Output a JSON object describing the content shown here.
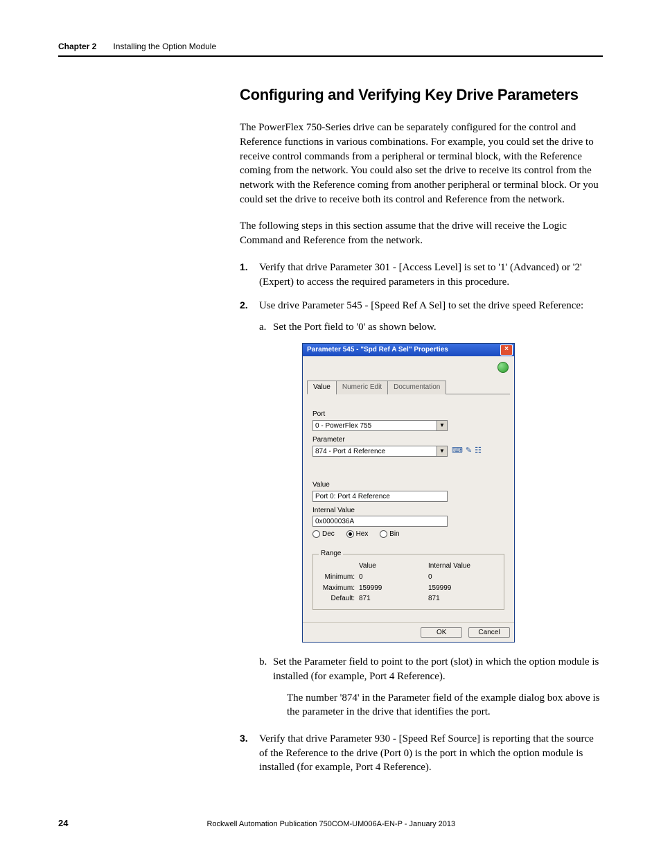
{
  "header": {
    "chapter": "Chapter 2",
    "title": "Installing the Option Module"
  },
  "section_heading": "Configuring and Verifying Key Drive Parameters",
  "para1": "The PowerFlex 750-Series drive can be separately configured for the control and Reference functions in various combinations. For example, you could set the drive to receive control commands from a peripheral or terminal block, with the Reference coming from the network. You could also set the drive to receive its control from the network with the Reference coming from another peripheral or terminal block. Or you could set the drive to receive both its control and Reference from the network.",
  "para2": "The following steps in this section assume that the drive will receive the Logic Command and Reference from the network.",
  "steps": {
    "s1": "Verify that drive Parameter 301 - [Access Level] is set to '1' (Advanced) or '2' (Expert) to access the required parameters in this procedure.",
    "s2": "Use drive Parameter 545 - [Speed Ref A Sel] to set the drive speed Reference:",
    "s2a": "Set the Port field to '0' as shown below.",
    "s2b": "Set the Parameter field to point to the port (slot) in which the option module is installed (for example, Port 4 Reference).",
    "s2b_note": "The number '874' in the Parameter field of the example dialog box above is the parameter in the drive that identifies the port.",
    "s3": "Verify that drive Parameter 930 - [Speed Ref Source] is reporting that the source of the Reference to the drive (Port 0) is the port in which the option module is installed (for example, Port 4 Reference)."
  },
  "dialog": {
    "title": "Parameter 545 - \"Spd Ref A Sel\" Properties",
    "tabs": {
      "value": "Value",
      "numeric": "Numeric Edit",
      "doc": "Documentation"
    },
    "labels": {
      "port": "Port",
      "parameter": "Parameter",
      "value": "Value",
      "internal_value": "Internal Value"
    },
    "fields": {
      "port": "0 - PowerFlex 755",
      "parameter": "874 - Port 4 Reference",
      "value": "Port 0: Port 4 Reference",
      "internal_value": "0x0000036A"
    },
    "radios": {
      "dec": "Dec",
      "hex": "Hex",
      "bin": "Bin"
    },
    "range": {
      "legend": "Range",
      "hdr_value": "Value",
      "hdr_internal": "Internal Value",
      "min_label": "Minimum:",
      "max_label": "Maximum:",
      "def_label": "Default:",
      "min_v": "0",
      "min_i": "0",
      "max_v": "159999",
      "max_i": "159999",
      "def_v": "871",
      "def_i": "871"
    },
    "buttons": {
      "ok": "OK",
      "cancel": "Cancel"
    }
  },
  "footer": {
    "page": "24",
    "publication": "Rockwell Automation Publication 750COM-UM006A-EN-P - January 2013"
  }
}
